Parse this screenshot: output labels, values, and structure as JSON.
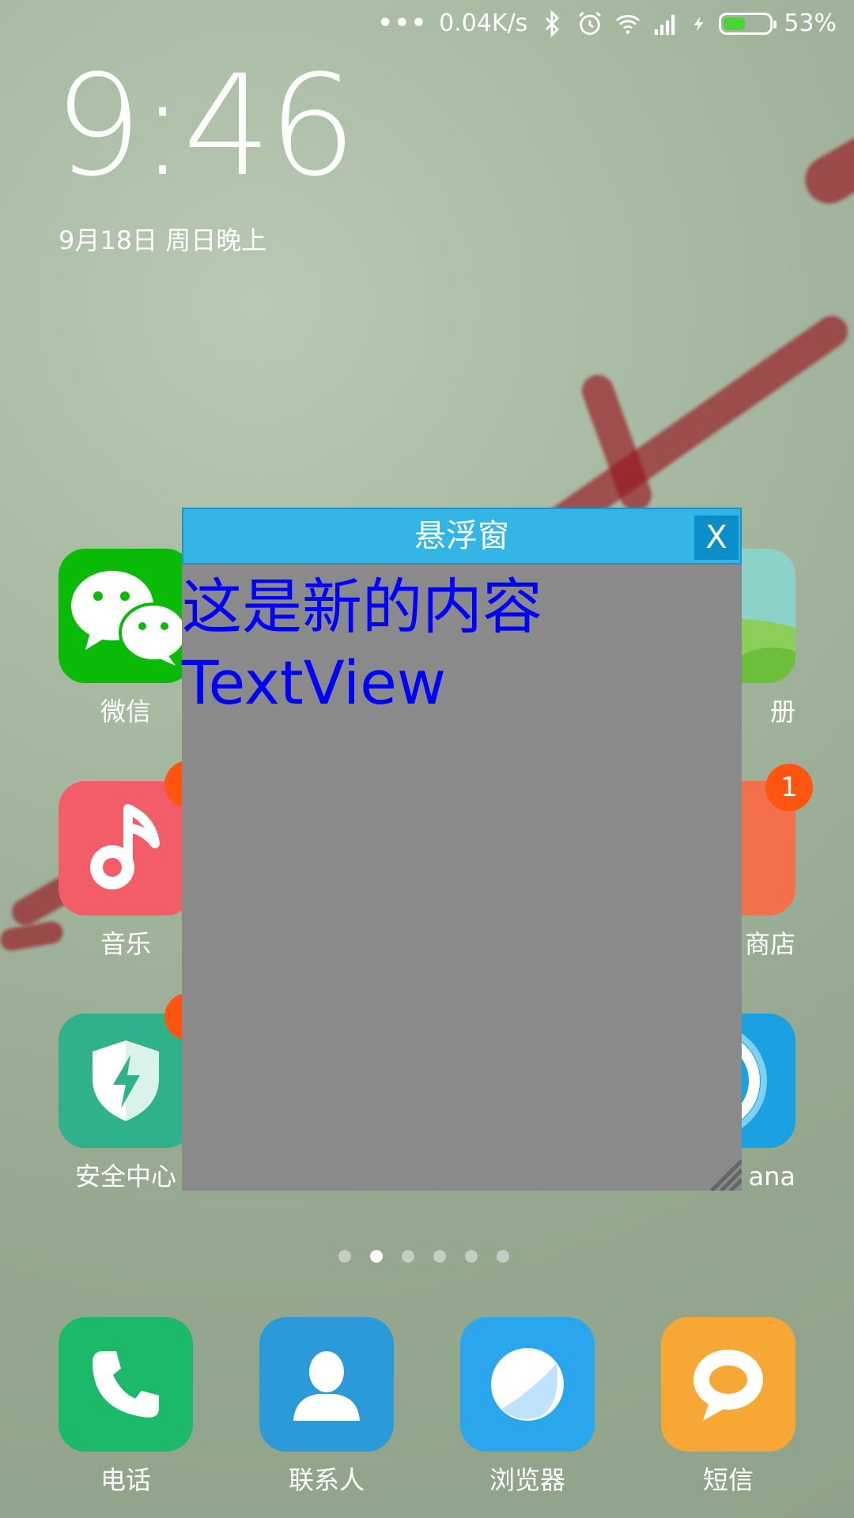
{
  "status_bar": {
    "more_icon": "more-dots-icon",
    "network_speed": "0.04K/s",
    "bluetooth_icon": "bluetooth-icon",
    "alarm_icon": "alarm-icon",
    "wifi_icon": "wifi-icon",
    "signal_icon": "signal-icon",
    "charging_icon": "charging-icon",
    "battery_level": 53,
    "battery_text": "53%",
    "battery_color": "#4cd138"
  },
  "lockscreen": {
    "time": "9:46",
    "date": "9月18日 周日晚上"
  },
  "apps": {
    "wechat": {
      "label": "微信",
      "icon": "wechat-icon",
      "color": "#09bb07"
    },
    "gallery": {
      "label": "册",
      "icon": "gallery-icon",
      "color": "#8bd2c9"
    },
    "music": {
      "label": "音乐",
      "icon": "music-note-icon",
      "color": "#f25d67"
    },
    "store": {
      "label": "商店",
      "icon": "store-icon",
      "color": "#f46f4c",
      "badge": "1"
    },
    "security": {
      "label": "安全中心",
      "icon": "shield-icon",
      "color": "#2fb18c"
    },
    "cortana": {
      "label": "ana",
      "icon": "cortana-icon",
      "color": "#1ba1e2"
    }
  },
  "dock": [
    {
      "label": "电话",
      "icon": "phone-icon",
      "color": "#1db96a"
    },
    {
      "label": "联系人",
      "icon": "contacts-icon",
      "color": "#2a9ad8"
    },
    {
      "label": "浏览器",
      "icon": "browser-icon",
      "color": "#2aa7ec"
    },
    {
      "label": "短信",
      "icon": "message-icon",
      "color": "#f7a834"
    }
  ],
  "page_indicator": {
    "active_index": 1,
    "count": 6
  },
  "float_window": {
    "title": "悬浮窗",
    "close_label": "X",
    "text_lines": [
      "这是新的内容",
      "TextView"
    ],
    "title_color": "#33b5e5",
    "text_color": "#0000ff",
    "body_color": "#8a8a8a"
  }
}
